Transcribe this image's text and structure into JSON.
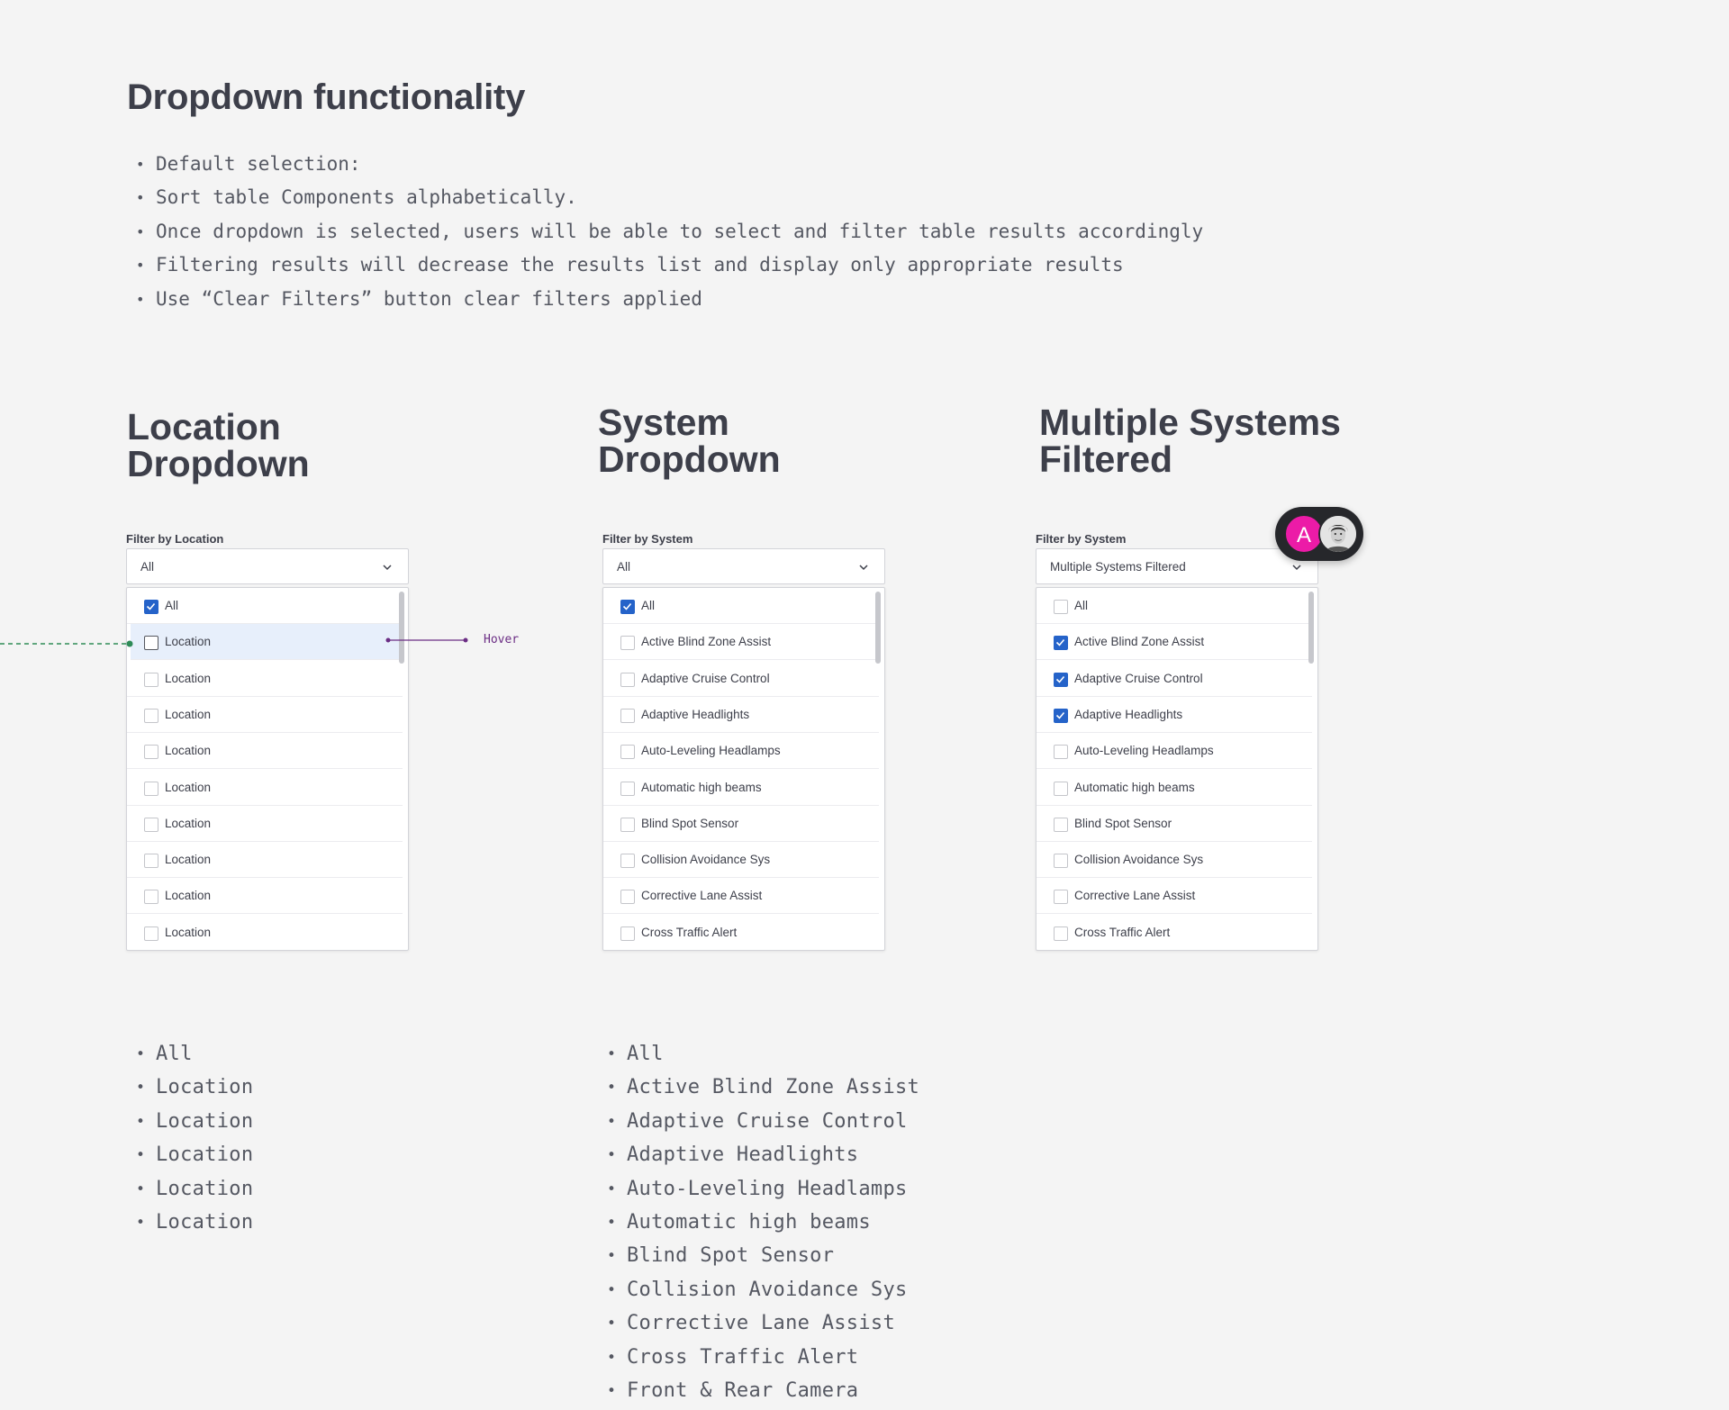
{
  "page": {
    "title": "Dropdown functionality",
    "notes": [
      "Default selection:",
      "Sort table Components alphabetically.",
      "Once dropdown is selected, users will be able to select and filter table results accordingly",
      "Filtering results will decrease the results list and display only appropriate results",
      "Use “Clear Filters” button clear filters applied"
    ]
  },
  "sections": {
    "location": {
      "title_line1": "Location",
      "title_line2": "Dropdown",
      "filter_label": "Filter by Location",
      "selected": "All"
    },
    "system": {
      "title_line1": "System",
      "title_line2": "Dropdown",
      "filter_label": "Filter by System",
      "selected": "All"
    },
    "multiple": {
      "title_line1": "Multiple Systems",
      "title_line2": "Filtered",
      "filter_label": "Filter by System",
      "selected": "Multiple Systems Filtered"
    }
  },
  "location_options": [
    {
      "label": "All",
      "checked": true
    },
    {
      "label": "Location",
      "checked": false,
      "hover": true
    },
    {
      "label": "Location",
      "checked": false
    },
    {
      "label": "Location",
      "checked": false
    },
    {
      "label": "Location",
      "checked": false
    },
    {
      "label": "Location",
      "checked": false
    },
    {
      "label": "Location",
      "checked": false
    },
    {
      "label": "Location",
      "checked": false
    },
    {
      "label": "Location",
      "checked": false
    },
    {
      "label": "Location",
      "checked": false
    }
  ],
  "system_options": [
    {
      "label": "All",
      "checked": true
    },
    {
      "label": "Active Blind Zone Assist",
      "checked": false
    },
    {
      "label": "Adaptive Cruise Control",
      "checked": false
    },
    {
      "label": "Adaptive Headlights",
      "checked": false
    },
    {
      "label": "Auto-Leveling Headlamps",
      "checked": false
    },
    {
      "label": "Automatic high beams",
      "checked": false
    },
    {
      "label": "Blind Spot Sensor",
      "checked": false
    },
    {
      "label": "Collision Avoidance Sys",
      "checked": false
    },
    {
      "label": "Corrective Lane Assist",
      "checked": false
    },
    {
      "label": "Cross Traffic Alert",
      "checked": false
    }
  ],
  "multiple_options": [
    {
      "label": "All",
      "checked": false
    },
    {
      "label": "Active Blind Zone Assist",
      "checked": true
    },
    {
      "label": "Adaptive Cruise Control",
      "checked": true
    },
    {
      "label": "Adaptive Headlights",
      "checked": true
    },
    {
      "label": "Auto-Leveling Headlamps",
      "checked": false
    },
    {
      "label": "Automatic high beams",
      "checked": false
    },
    {
      "label": "Blind Spot Sensor",
      "checked": false
    },
    {
      "label": "Collision Avoidance Sys",
      "checked": false
    },
    {
      "label": "Corrective Lane Assist",
      "checked": false
    },
    {
      "label": "Cross Traffic Alert",
      "checked": false
    }
  ],
  "hover_annotation": "Hover",
  "location_list": [
    "All",
    "Location",
    "Location",
    "Location",
    "Location",
    "Location"
  ],
  "system_list": [
    "All",
    "Active Blind Zone Assist",
    "Adaptive Cruise Control",
    "Adaptive Headlights",
    "Auto-Leveling Headlamps",
    "Automatic high beams",
    "Blind Spot Sensor",
    "Collision Avoidance Sys",
    "Corrective Lane Assist",
    "Cross Traffic Alert",
    "Front & Rear Camera"
  ],
  "avatar": {
    "initial": "A"
  },
  "colors": {
    "accent": "#2563c9",
    "hover_bg": "#e7effb",
    "annotation_green": "#2e8b57",
    "annotation_purple": "#6b2d84",
    "avatar_pink": "#ec1ba7"
  },
  "icons": {
    "dropdown": "chevron-down-icon",
    "checkbox_checked": "check-icon"
  }
}
